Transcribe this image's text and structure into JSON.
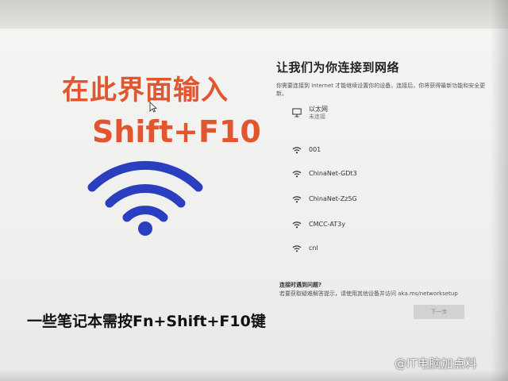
{
  "annotation": {
    "line1": "在此界面输入",
    "line2": "Shift+F10",
    "bottom_note": "一些笔记本需按Fn+Shift+F10键",
    "watermark": "@IT电脑加点料"
  },
  "panel": {
    "title": "让我们为你连接到网络",
    "description": "你需要连接到 Internet 才能继续设置你的设备。连接后，你将获得最新功能和安全更新。",
    "ethernet": {
      "label": "以太网",
      "status": "未连接",
      "icon": "monitor-icon"
    },
    "networks": [
      {
        "ssid": "001",
        "icon": "wifi-secured-icon"
      },
      {
        "ssid": "ChinaNet-GDt3",
        "icon": "wifi-secured-icon"
      },
      {
        "ssid": "ChinaNet-Zz5G",
        "icon": "wifi-secured-icon"
      },
      {
        "ssid": "CMCC-AT3y",
        "icon": "wifi-secured-icon"
      },
      {
        "ssid": "cnl",
        "icon": "wifi-secured-icon"
      }
    ],
    "footer_title": "连接时遇到问题?",
    "footer_text": "若要获取疑难解答提示，请使用其他设备并访问 aka.ms/networksetup",
    "next_button": "下一步"
  },
  "colors": {
    "annotation_red": "#e2562f",
    "wifi_blue": "#2a3fbf"
  }
}
